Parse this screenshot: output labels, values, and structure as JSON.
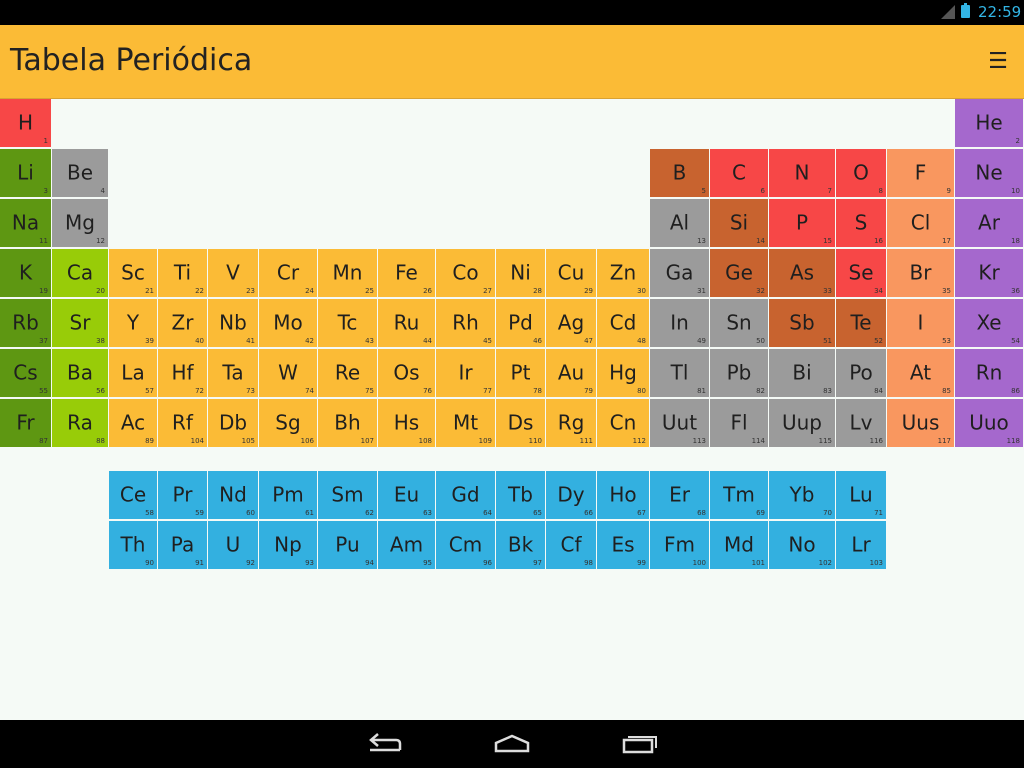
{
  "status_bar": {
    "time": "22:59"
  },
  "header": {
    "title": "Tabela Periódica",
    "menu_icon": "menu-icon"
  },
  "colors": {
    "hydrogen": "#f74747",
    "alkali": "#5e9712",
    "alkaline": "#98cc08",
    "transition": "#fbbb36",
    "post_transition": "#9b9b9b",
    "metalloid": "#c8632f",
    "nonmetal": "#f74747",
    "halogen": "#f9975f",
    "noble": "#a568cd",
    "lanthanide": "#33b0e0"
  },
  "elements": [
    {
      "s": "H",
      "n": "1",
      "r": 1,
      "c": 1,
      "cat": "hydrogen"
    },
    {
      "s": "He",
      "n": "2",
      "r": 1,
      "c": 18,
      "cat": "noble"
    },
    {
      "s": "Li",
      "n": "3",
      "r": 2,
      "c": 1,
      "cat": "alkali"
    },
    {
      "s": "Be",
      "n": "4",
      "r": 2,
      "c": 2,
      "cat": "post_transition"
    },
    {
      "s": "B",
      "n": "5",
      "r": 2,
      "c": 13,
      "cat": "metalloid"
    },
    {
      "s": "C",
      "n": "6",
      "r": 2,
      "c": 14,
      "cat": "nonmetal"
    },
    {
      "s": "N",
      "n": "7",
      "r": 2,
      "c": 15,
      "cat": "nonmetal"
    },
    {
      "s": "O",
      "n": "8",
      "r": 2,
      "c": 16,
      "cat": "nonmetal"
    },
    {
      "s": "F",
      "n": "9",
      "r": 2,
      "c": 17,
      "cat": "halogen"
    },
    {
      "s": "Ne",
      "n": "10",
      "r": 2,
      "c": 18,
      "cat": "noble"
    },
    {
      "s": "Na",
      "n": "11",
      "r": 3,
      "c": 1,
      "cat": "alkali"
    },
    {
      "s": "Mg",
      "n": "12",
      "r": 3,
      "c": 2,
      "cat": "post_transition"
    },
    {
      "s": "Al",
      "n": "13",
      "r": 3,
      "c": 13,
      "cat": "post_transition"
    },
    {
      "s": "Si",
      "n": "14",
      "r": 3,
      "c": 14,
      "cat": "metalloid"
    },
    {
      "s": "P",
      "n": "15",
      "r": 3,
      "c": 15,
      "cat": "nonmetal"
    },
    {
      "s": "S",
      "n": "16",
      "r": 3,
      "c": 16,
      "cat": "nonmetal"
    },
    {
      "s": "Cl",
      "n": "17",
      "r": 3,
      "c": 17,
      "cat": "halogen"
    },
    {
      "s": "Ar",
      "n": "18",
      "r": 3,
      "c": 18,
      "cat": "noble"
    },
    {
      "s": "K",
      "n": "19",
      "r": 4,
      "c": 1,
      "cat": "alkali"
    },
    {
      "s": "Ca",
      "n": "20",
      "r": 4,
      "c": 2,
      "cat": "alkaline"
    },
    {
      "s": "Sc",
      "n": "21",
      "r": 4,
      "c": 3,
      "cat": "transition"
    },
    {
      "s": "Ti",
      "n": "22",
      "r": 4,
      "c": 4,
      "cat": "transition"
    },
    {
      "s": "V",
      "n": "23",
      "r": 4,
      "c": 5,
      "cat": "transition"
    },
    {
      "s": "Cr",
      "n": "24",
      "r": 4,
      "c": 6,
      "cat": "transition"
    },
    {
      "s": "Mn",
      "n": "25",
      "r": 4,
      "c": 7,
      "cat": "transition"
    },
    {
      "s": "Fe",
      "n": "26",
      "r": 4,
      "c": 8,
      "cat": "transition"
    },
    {
      "s": "Co",
      "n": "27",
      "r": 4,
      "c": 9,
      "cat": "transition"
    },
    {
      "s": "Ni",
      "n": "28",
      "r": 4,
      "c": 10,
      "cat": "transition"
    },
    {
      "s": "Cu",
      "n": "29",
      "r": 4,
      "c": 11,
      "cat": "transition"
    },
    {
      "s": "Zn",
      "n": "30",
      "r": 4,
      "c": 12,
      "cat": "transition"
    },
    {
      "s": "Ga",
      "n": "31",
      "r": 4,
      "c": 13,
      "cat": "post_transition"
    },
    {
      "s": "Ge",
      "n": "32",
      "r": 4,
      "c": 14,
      "cat": "metalloid"
    },
    {
      "s": "As",
      "n": "33",
      "r": 4,
      "c": 15,
      "cat": "metalloid"
    },
    {
      "s": "Se",
      "n": "34",
      "r": 4,
      "c": 16,
      "cat": "nonmetal"
    },
    {
      "s": "Br",
      "n": "35",
      "r": 4,
      "c": 17,
      "cat": "halogen"
    },
    {
      "s": "Kr",
      "n": "36",
      "r": 4,
      "c": 18,
      "cat": "noble"
    },
    {
      "s": "Rb",
      "n": "37",
      "r": 5,
      "c": 1,
      "cat": "alkali"
    },
    {
      "s": "Sr",
      "n": "38",
      "r": 5,
      "c": 2,
      "cat": "alkaline"
    },
    {
      "s": "Y",
      "n": "39",
      "r": 5,
      "c": 3,
      "cat": "transition"
    },
    {
      "s": "Zr",
      "n": "40",
      "r": 5,
      "c": 4,
      "cat": "transition"
    },
    {
      "s": "Nb",
      "n": "41",
      "r": 5,
      "c": 5,
      "cat": "transition"
    },
    {
      "s": "Mo",
      "n": "42",
      "r": 5,
      "c": 6,
      "cat": "transition"
    },
    {
      "s": "Tc",
      "n": "43",
      "r": 5,
      "c": 7,
      "cat": "transition"
    },
    {
      "s": "Ru",
      "n": "44",
      "r": 5,
      "c": 8,
      "cat": "transition"
    },
    {
      "s": "Rh",
      "n": "45",
      "r": 5,
      "c": 9,
      "cat": "transition"
    },
    {
      "s": "Pd",
      "n": "46",
      "r": 5,
      "c": 10,
      "cat": "transition"
    },
    {
      "s": "Ag",
      "n": "47",
      "r": 5,
      "c": 11,
      "cat": "transition"
    },
    {
      "s": "Cd",
      "n": "48",
      "r": 5,
      "c": 12,
      "cat": "transition"
    },
    {
      "s": "In",
      "n": "49",
      "r": 5,
      "c": 13,
      "cat": "post_transition"
    },
    {
      "s": "Sn",
      "n": "50",
      "r": 5,
      "c": 14,
      "cat": "post_transition"
    },
    {
      "s": "Sb",
      "n": "51",
      "r": 5,
      "c": 15,
      "cat": "metalloid"
    },
    {
      "s": "Te",
      "n": "52",
      "r": 5,
      "c": 16,
      "cat": "metalloid"
    },
    {
      "s": "I",
      "n": "53",
      "r": 5,
      "c": 17,
      "cat": "halogen"
    },
    {
      "s": "Xe",
      "n": "54",
      "r": 5,
      "c": 18,
      "cat": "noble"
    },
    {
      "s": "Cs",
      "n": "55",
      "r": 6,
      "c": 1,
      "cat": "alkali"
    },
    {
      "s": "Ba",
      "n": "56",
      "r": 6,
      "c": 2,
      "cat": "alkaline"
    },
    {
      "s": "La",
      "n": "57",
      "r": 6,
      "c": 3,
      "cat": "transition"
    },
    {
      "s": "Hf",
      "n": "72",
      "r": 6,
      "c": 4,
      "cat": "transition"
    },
    {
      "s": "Ta",
      "n": "73",
      "r": 6,
      "c": 5,
      "cat": "transition"
    },
    {
      "s": "W",
      "n": "74",
      "r": 6,
      "c": 6,
      "cat": "transition"
    },
    {
      "s": "Re",
      "n": "75",
      "r": 6,
      "c": 7,
      "cat": "transition"
    },
    {
      "s": "Os",
      "n": "76",
      "r": 6,
      "c": 8,
      "cat": "transition"
    },
    {
      "s": "Ir",
      "n": "77",
      "r": 6,
      "c": 9,
      "cat": "transition"
    },
    {
      "s": "Pt",
      "n": "78",
      "r": 6,
      "c": 10,
      "cat": "transition"
    },
    {
      "s": "Au",
      "n": "79",
      "r": 6,
      "c": 11,
      "cat": "transition"
    },
    {
      "s": "Hg",
      "n": "80",
      "r": 6,
      "c": 12,
      "cat": "transition"
    },
    {
      "s": "Tl",
      "n": "81",
      "r": 6,
      "c": 13,
      "cat": "post_transition"
    },
    {
      "s": "Pb",
      "n": "82",
      "r": 6,
      "c": 14,
      "cat": "post_transition"
    },
    {
      "s": "Bi",
      "n": "83",
      "r": 6,
      "c": 15,
      "cat": "post_transition"
    },
    {
      "s": "Po",
      "n": "84",
      "r": 6,
      "c": 16,
      "cat": "post_transition"
    },
    {
      "s": "At",
      "n": "85",
      "r": 6,
      "c": 17,
      "cat": "halogen"
    },
    {
      "s": "Rn",
      "n": "86",
      "r": 6,
      "c": 18,
      "cat": "noble"
    },
    {
      "s": "Fr",
      "n": "87",
      "r": 7,
      "c": 1,
      "cat": "alkali"
    },
    {
      "s": "Ra",
      "n": "88",
      "r": 7,
      "c": 2,
      "cat": "alkaline"
    },
    {
      "s": "Ac",
      "n": "89",
      "r": 7,
      "c": 3,
      "cat": "transition"
    },
    {
      "s": "Rf",
      "n": "104",
      "r": 7,
      "c": 4,
      "cat": "transition"
    },
    {
      "s": "Db",
      "n": "105",
      "r": 7,
      "c": 5,
      "cat": "transition"
    },
    {
      "s": "Sg",
      "n": "106",
      "r": 7,
      "c": 6,
      "cat": "transition"
    },
    {
      "s": "Bh",
      "n": "107",
      "r": 7,
      "c": 7,
      "cat": "transition"
    },
    {
      "s": "Hs",
      "n": "108",
      "r": 7,
      "c": 8,
      "cat": "transition"
    },
    {
      "s": "Mt",
      "n": "109",
      "r": 7,
      "c": 9,
      "cat": "transition"
    },
    {
      "s": "Ds",
      "n": "110",
      "r": 7,
      "c": 10,
      "cat": "transition"
    },
    {
      "s": "Rg",
      "n": "111",
      "r": 7,
      "c": 11,
      "cat": "transition"
    },
    {
      "s": "Cn",
      "n": "112",
      "r": 7,
      "c": 12,
      "cat": "transition"
    },
    {
      "s": "Uut",
      "n": "113",
      "r": 7,
      "c": 13,
      "cat": "post_transition"
    },
    {
      "s": "Fl",
      "n": "114",
      "r": 7,
      "c": 14,
      "cat": "post_transition"
    },
    {
      "s": "Uup",
      "n": "115",
      "r": 7,
      "c": 15,
      "cat": "post_transition"
    },
    {
      "s": "Lv",
      "n": "116",
      "r": 7,
      "c": 16,
      "cat": "post_transition"
    },
    {
      "s": "Uus",
      "n": "117",
      "r": 7,
      "c": 17,
      "cat": "halogen"
    },
    {
      "s": "Uuo",
      "n": "118",
      "r": 7,
      "c": 18,
      "cat": "noble"
    },
    {
      "s": "Ce",
      "n": "58",
      "r": 8,
      "c": 3,
      "cat": "lanthanide"
    },
    {
      "s": "Pr",
      "n": "59",
      "r": 8,
      "c": 4,
      "cat": "lanthanide"
    },
    {
      "s": "Nd",
      "n": "60",
      "r": 8,
      "c": 5,
      "cat": "lanthanide"
    },
    {
      "s": "Pm",
      "n": "61",
      "r": 8,
      "c": 6,
      "cat": "lanthanide"
    },
    {
      "s": "Sm",
      "n": "62",
      "r": 8,
      "c": 7,
      "cat": "lanthanide"
    },
    {
      "s": "Eu",
      "n": "63",
      "r": 8,
      "c": 8,
      "cat": "lanthanide"
    },
    {
      "s": "Gd",
      "n": "64",
      "r": 8,
      "c": 9,
      "cat": "lanthanide"
    },
    {
      "s": "Tb",
      "n": "65",
      "r": 8,
      "c": 10,
      "cat": "lanthanide"
    },
    {
      "s": "Dy",
      "n": "66",
      "r": 8,
      "c": 11,
      "cat": "lanthanide"
    },
    {
      "s": "Ho",
      "n": "67",
      "r": 8,
      "c": 12,
      "cat": "lanthanide"
    },
    {
      "s": "Er",
      "n": "68",
      "r": 8,
      "c": 13,
      "cat": "lanthanide"
    },
    {
      "s": "Tm",
      "n": "69",
      "r": 8,
      "c": 14,
      "cat": "lanthanide"
    },
    {
      "s": "Yb",
      "n": "70",
      "r": 8,
      "c": 15,
      "cat": "lanthanide"
    },
    {
      "s": "Lu",
      "n": "71",
      "r": 8,
      "c": 16,
      "cat": "lanthanide"
    },
    {
      "s": "Th",
      "n": "90",
      "r": 9,
      "c": 3,
      "cat": "lanthanide"
    },
    {
      "s": "Pa",
      "n": "91",
      "r": 9,
      "c": 4,
      "cat": "lanthanide"
    },
    {
      "s": "U",
      "n": "92",
      "r": 9,
      "c": 5,
      "cat": "lanthanide"
    },
    {
      "s": "Np",
      "n": "93",
      "r": 9,
      "c": 6,
      "cat": "lanthanide"
    },
    {
      "s": "Pu",
      "n": "94",
      "r": 9,
      "c": 7,
      "cat": "lanthanide"
    },
    {
      "s": "Am",
      "n": "95",
      "r": 9,
      "c": 8,
      "cat": "lanthanide"
    },
    {
      "s": "Cm",
      "n": "96",
      "r": 9,
      "c": 9,
      "cat": "lanthanide"
    },
    {
      "s": "Bk",
      "n": "97",
      "r": 9,
      "c": 10,
      "cat": "lanthanide"
    },
    {
      "s": "Cf",
      "n": "98",
      "r": 9,
      "c": 11,
      "cat": "lanthanide"
    },
    {
      "s": "Es",
      "n": "99",
      "r": 9,
      "c": 12,
      "cat": "lanthanide"
    },
    {
      "s": "Fm",
      "n": "100",
      "r": 9,
      "c": 13,
      "cat": "lanthanide"
    },
    {
      "s": "Md",
      "n": "101",
      "r": 9,
      "c": 14,
      "cat": "lanthanide"
    },
    {
      "s": "No",
      "n": "102",
      "r": 9,
      "c": 15,
      "cat": "lanthanide"
    },
    {
      "s": "Lr",
      "n": "103",
      "r": 9,
      "c": 16,
      "cat": "lanthanide"
    }
  ],
  "nav_bar": {
    "icons": [
      "back-icon",
      "home-icon",
      "recent-apps-icon"
    ]
  }
}
